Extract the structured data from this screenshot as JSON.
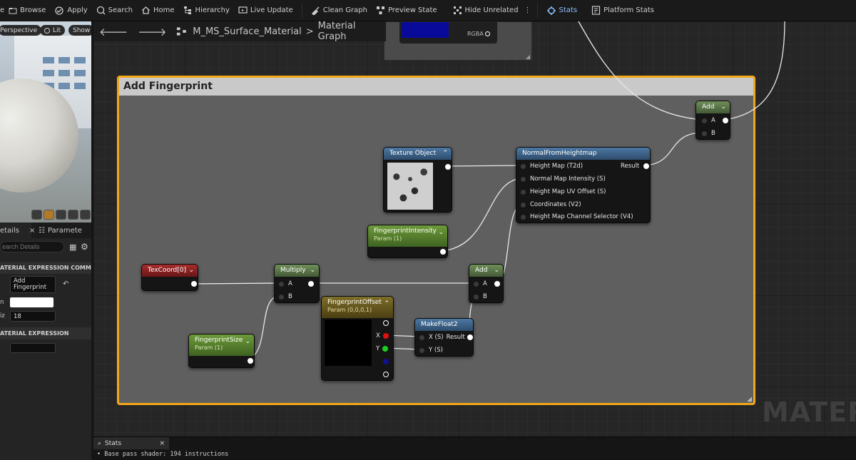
{
  "toolbar": {
    "items": [
      {
        "label": "Browse",
        "icon": "browse-icon"
      },
      {
        "label": "Apply",
        "icon": "apply-icon"
      },
      {
        "label": "Search",
        "icon": "search-icon"
      },
      {
        "label": "Home",
        "icon": "home-icon"
      },
      {
        "label": "Hierarchy",
        "icon": "hierarchy-icon"
      },
      {
        "label": "Live Update",
        "icon": "live-update-icon"
      },
      {
        "label": "Clean Graph",
        "icon": "clean-graph-icon"
      },
      {
        "label": "Preview State",
        "icon": "preview-state-icon"
      },
      {
        "label": "Hide Unrelated",
        "icon": "hide-unrelated-icon"
      },
      {
        "label": "Stats",
        "icon": "stats-icon"
      },
      {
        "label": "Platform Stats",
        "icon": "platform-stats-icon"
      }
    ]
  },
  "viewport": {
    "perspective_label": "Perspective",
    "lit_label": "Lit",
    "show_label": "Show"
  },
  "details": {
    "tab_details": "etails",
    "tab_parameters": "Paramete",
    "search_placeholder": "earch Details",
    "section_comment": "ATERIAL EXPRESSION COMMENT",
    "comment_text": "Add Fingerprint",
    "font_size_label": "iz",
    "font_size_value": "18",
    "color_label": "n",
    "section_expression": "ATERIAL EXPRESSION"
  },
  "breadcrumb": {
    "asset": "M_MS_Surface_Material",
    "separator": ">",
    "graph": "Material Graph"
  },
  "graph": {
    "comment_title": "Add Fingerprint",
    "watermark": "MATERI",
    "top_node_label": "RGBA",
    "nodes": {
      "add_top": {
        "title": "Add",
        "pin_a": "A",
        "pin_b": "B"
      },
      "texture_object": {
        "title": "Texture Object"
      },
      "normal_from_heightmap": {
        "title": "NormalFromHeightmap",
        "pins": [
          "Height Map (T2d)",
          "Normal Map Intensity (S)",
          "Height Map UV Offset (S)",
          "Coordinates (V2)",
          "Height Map Channel Selector (V4)"
        ],
        "output": "Result"
      },
      "fingerprint_intensity": {
        "title": "FingerprintIntensity",
        "subtitle": "Param (1)"
      },
      "texcoord": {
        "title": "TexCoord[0]"
      },
      "multiply": {
        "title": "Multiply",
        "pin_a": "A",
        "pin_b": "B"
      },
      "add_mid": {
        "title": "Add",
        "pin_a": "A",
        "pin_b": "B"
      },
      "fingerprint_offset": {
        "title": "FingerprintOffset",
        "subtitle": "Param (0,0,0,1)",
        "pin_x": "X",
        "pin_y": "Y"
      },
      "make_float2": {
        "title": "MakeFloat2",
        "pin_x": "X (S)",
        "pin_y": "Y (S)",
        "output": "Result"
      },
      "fingerprint_size": {
        "title": "FingerprintSize",
        "subtitle": "Param (1)"
      }
    }
  },
  "stats": {
    "tab_label": "Stats",
    "close_label": "×",
    "line": "Base pass shader: 194 instructions"
  },
  "colors": {
    "comment_border": "#f2a71b",
    "param_header": "#6d9a3a",
    "texcoord_header": "#a82c2c",
    "function_header": "#4d78a3",
    "math_header": "#6f8f5a"
  }
}
